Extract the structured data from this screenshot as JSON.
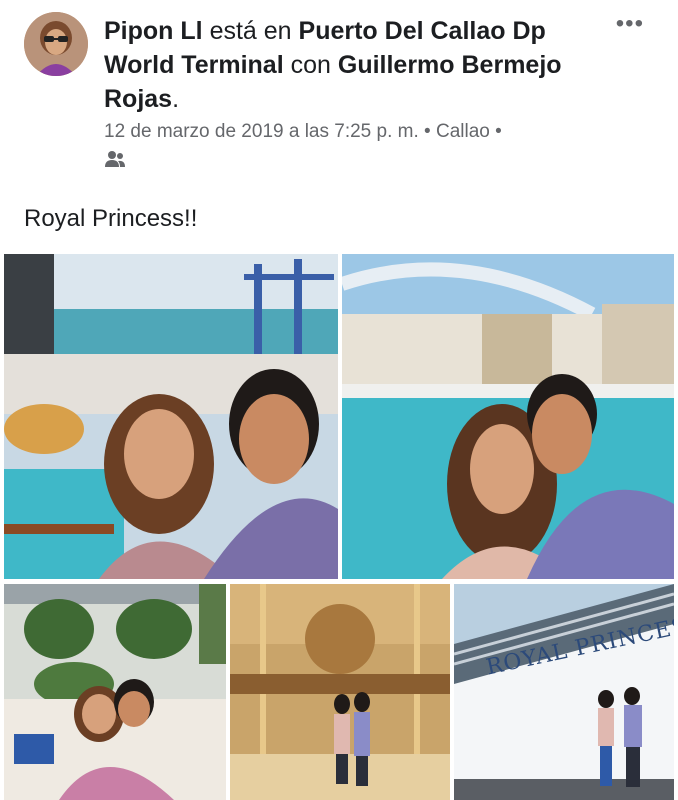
{
  "post": {
    "author": "Pipon Ll",
    "verb_esta": "está en",
    "place": "Puerto Del Callao Dp World Terminal",
    "connector": "con",
    "tagged": "Guillermo Bermejo Rojas",
    "period": ".",
    "timestamp": "12 de marzo de 2019 a las 7:25 p. m.",
    "separator": " • ",
    "location": "Callao",
    "caption": "Royal Princess!!",
    "more_label": "•••"
  },
  "photos": [
    {
      "icon": "photo-pool-deck-selfie"
    },
    {
      "icon": "photo-pool-couple"
    },
    {
      "icon": "photo-cabana-couple"
    },
    {
      "icon": "photo-atrium-couple"
    },
    {
      "icon": "photo-ship-hull",
      "ship_text": "ROYAL PRINCESS"
    }
  ],
  "icons": {
    "audience": "friends-icon",
    "more": "more-options-icon"
  },
  "colors": {
    "text": "#1c1e21",
    "meta": "#65676b",
    "pool": "#3fb8c8",
    "sky": "#9cc7e6"
  }
}
